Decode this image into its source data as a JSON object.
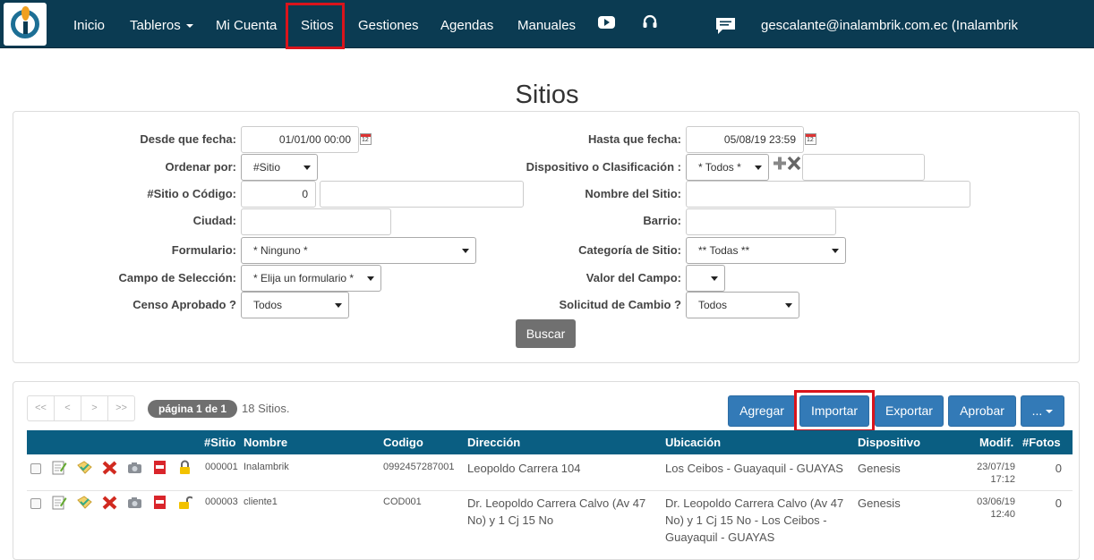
{
  "navbar": {
    "items": [
      {
        "label": "Inicio"
      },
      {
        "label": "Tableros"
      },
      {
        "label": "Mi Cuenta"
      },
      {
        "label": "Sitios"
      },
      {
        "label": "Gestiones"
      },
      {
        "label": "Agendas"
      },
      {
        "label": "Manuales"
      }
    ],
    "user": "gescalante@inalambrik.com.ec (Inalambrik Capacitaciòn)"
  },
  "page": {
    "title": "Sitios"
  },
  "filters": {
    "desde_label": "Desde que fecha:",
    "desde_value": "01/01/00 00:00",
    "hasta_label": "Hasta que fecha:",
    "hasta_value": "05/08/19 23:59",
    "ordenar_label": "Ordenar por:",
    "ordenar_value": "#Sitio",
    "dispositivo_label": "Dispositivo o Clasificación :",
    "dispositivo_value": "* Todos *",
    "sitio_label": "#Sitio o Código:",
    "sitio_value": "0",
    "nombre_label": "Nombre del Sitio:",
    "ciudad_label": "Ciudad:",
    "barrio_label": "Barrio:",
    "formulario_label": "Formulario:",
    "formulario_value": "* Ninguno *",
    "categoria_label": "Categoría de Sitio:",
    "categoria_value": "** Todas **",
    "campo_label": "Campo de Selección:",
    "campo_value": "* Elija un formulario *",
    "valor_label": "Valor del Campo:",
    "censo_label": "Censo Aprobado ?",
    "censo_value": "Todos",
    "solicitud_label": "Solicitud de Cambio ?",
    "solicitud_value": "Todos",
    "search_button": "Buscar"
  },
  "results": {
    "pager": [
      "<<",
      "<",
      ">",
      ">>"
    ],
    "page_label": "página 1 de 1",
    "count": "18 Sitios.",
    "actions": {
      "add": "Agregar",
      "import": "Importar",
      "export": "Exportar",
      "approve": "Aprobar",
      "more": "..."
    },
    "columns": {
      "sitio": "#Sitio",
      "nombre": "Nombre",
      "codigo": "Codigo",
      "direccion": "Dirección",
      "ubicacion": "Ubicación",
      "dispositivo": "Dispositivo",
      "modif": "Modif.",
      "fotos": "#Fotos"
    },
    "rows": [
      {
        "sitio": "000001",
        "nombre": "Inalambrik",
        "codigo": "0992457287001",
        "direccion": "Leopoldo Carrera 104",
        "ubicacion": "Los Ceibos - Guayaquil - GUAYAS",
        "dispositivo": "Genesis",
        "modif_date": "23/07/19",
        "modif_time": "17:12",
        "fotos": "0"
      },
      {
        "sitio": "000003",
        "nombre": "cliente1",
        "codigo": "COD001",
        "direccion": "Dr. Leopoldo Carrera Calvo (Av 47 No) y 1 Cj 15 No",
        "ubicacion": "Dr. Leopoldo Carrera Calvo (Av 47 No) y 1 Cj 15 No - Los Ceibos - Guayaquil - GUAYAS",
        "dispositivo": "Genesis",
        "modif_date": "03/06/19",
        "modif_time": "12:40",
        "fotos": "0"
      }
    ]
  }
}
